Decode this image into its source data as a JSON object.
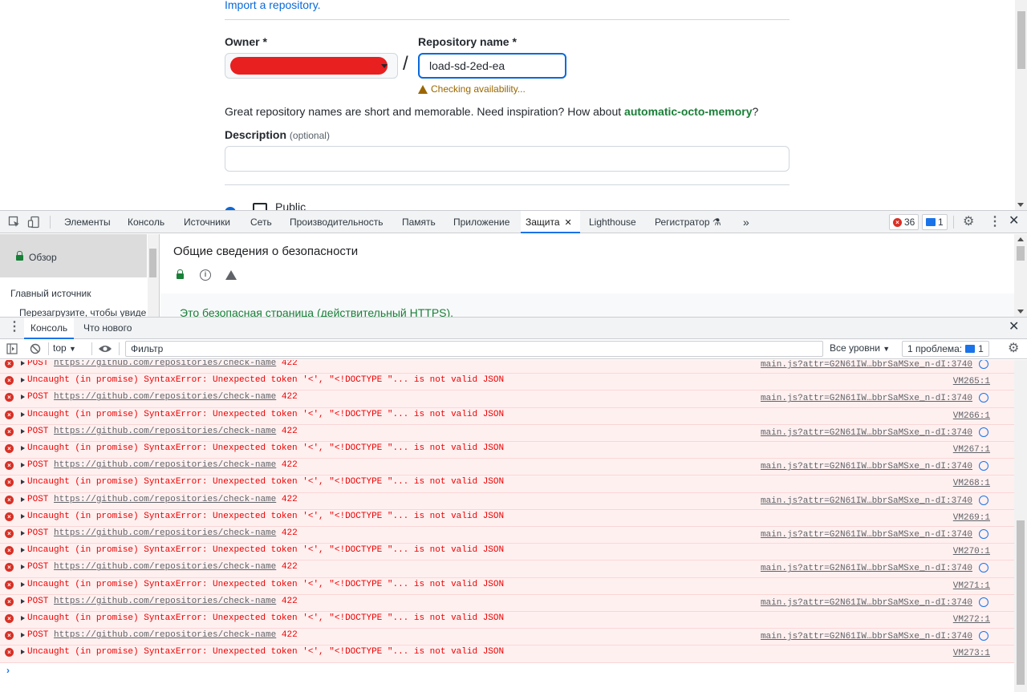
{
  "page": {
    "import_link": "Import a repository.",
    "owner_label": "Owner *",
    "repo_label": "Repository name *",
    "repo_value": "load-sd-2ed-ea",
    "slash": "/",
    "checking": "Checking availability...",
    "great_text": "Great repository names are short and memorable. Need inspiration? How about ",
    "suggestion": "automatic-octo-memory",
    "great_end": "?",
    "description_label": "Description",
    "optional": "(optional)",
    "public_label": "Public"
  },
  "devtools": {
    "tabs": [
      "Элементы",
      "Консоль",
      "Источники",
      "Сеть",
      "Производительность",
      "Память",
      "Приложение",
      "Защита",
      "Lighthouse",
      "Регистратор"
    ],
    "active_tab": "Защита",
    "more": "»",
    "error_count": "36",
    "message_count": "1",
    "security": {
      "overview": "Обзор",
      "main_source": "Главный источник",
      "reload_hint": "Перезагрузите, чтобы увиде",
      "title": "Общие сведения о безопасности",
      "secure_text": "Это безопасная страница (действительный HTTPS)."
    },
    "drawer": {
      "tabs": [
        "Консоль",
        "Что нового"
      ],
      "context": "top",
      "filter_placeholder": "Фильтр",
      "levels": "Все уровни",
      "issues_label": "1 проблема:",
      "issues_count": "1"
    },
    "log": {
      "post_prefix": "POST ",
      "post_url": "https://github.com/repositories/check-name",
      "post_status": " 422",
      "post_source": "main.js?attr=G2N61IW…bbrSaMSxe_n-dI:3740",
      "error_text": "Uncaught (in promise) SyntaxError: Unexpected token '<', \"<!DOCTYPE \"... is not valid JSON",
      "vm_sources": [
        "VM265:1",
        "VM266:1",
        "VM267:1",
        "VM268:1",
        "VM269:1",
        "VM270:1",
        "VM271:1",
        "VM272:1",
        "VM273:1"
      ],
      "prompt": "›"
    }
  },
  "colors": {
    "accent": "#1a73e8",
    "error": "#e00",
    "error_bg": "#fff0f0",
    "redaction": "#e8201f",
    "github_blue": "#0969da",
    "github_green": "#1a7f37"
  }
}
